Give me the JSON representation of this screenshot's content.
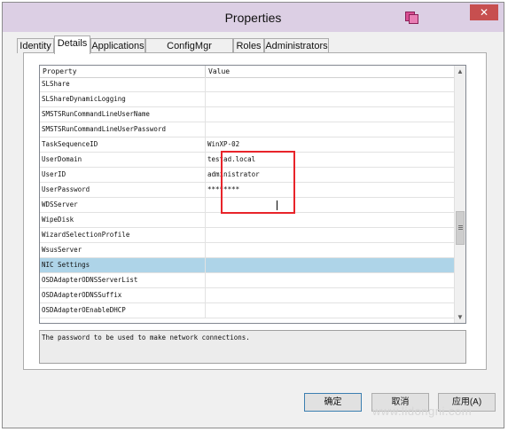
{
  "window": {
    "title": "Properties",
    "close_label": "✕"
  },
  "tabs": [
    {
      "label": "Identity"
    },
    {
      "label": "Details"
    },
    {
      "label": "Applications"
    },
    {
      "label": "ConfigMgr Packages"
    },
    {
      "label": "Roles"
    },
    {
      "label": "Administrators"
    }
  ],
  "active_tab": "Details",
  "grid": {
    "headers": {
      "property": "Property",
      "value": "Value"
    },
    "rows": [
      {
        "property": "SLShare",
        "value": ""
      },
      {
        "property": "SLShareDynamicLogging",
        "value": ""
      },
      {
        "property": "SMSTSRunCommandLineUserName",
        "value": ""
      },
      {
        "property": "SMSTSRunCommandLineUserPassword",
        "value": ""
      },
      {
        "property": "TaskSequenceID",
        "value": "WinXP-02"
      },
      {
        "property": "UserDomain",
        "value": "testad.local"
      },
      {
        "property": "UserID",
        "value": "administrator"
      },
      {
        "property": "UserPassword",
        "value": "********"
      },
      {
        "property": "WDSServer",
        "value": ""
      },
      {
        "property": "WipeDisk",
        "value": ""
      },
      {
        "property": "WizardSelectionProfile",
        "value": ""
      },
      {
        "property": "WsusServer",
        "value": ""
      },
      {
        "property": "NIC Settings",
        "value": ""
      },
      {
        "property": "OSDAdapterODNSServerList",
        "value": ""
      },
      {
        "property": "OSDAdapterODNSSuffix",
        "value": ""
      },
      {
        "property": "OSDAdapterOEnableDHCP",
        "value": ""
      }
    ],
    "selected_row": "NIC Settings"
  },
  "description": "The password to be used to make network connections.",
  "buttons": {
    "ok": "确定",
    "cancel": "取消",
    "apply": "应用(A)"
  },
  "watermark": "www.lidongni.com",
  "colors": {
    "titlebar": "#dccfe4",
    "selection": "#aed4e8",
    "highlight_box": "#e8242a"
  }
}
